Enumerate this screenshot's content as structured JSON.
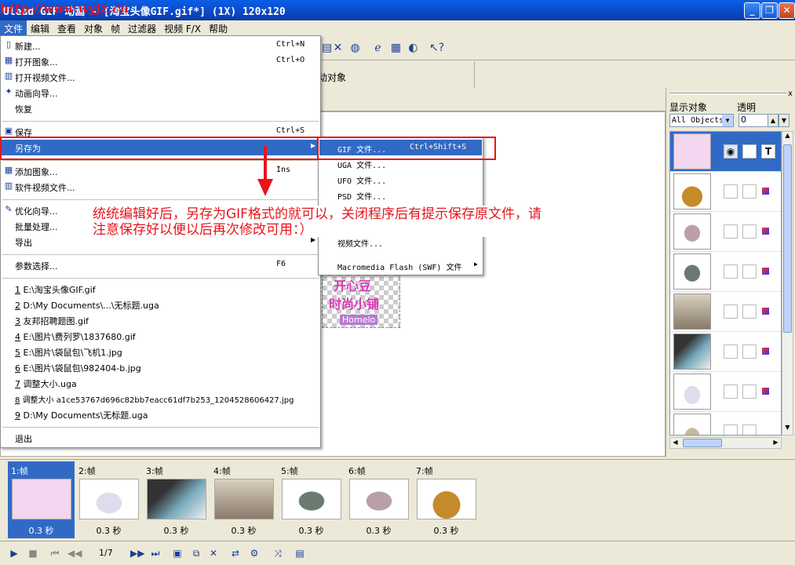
{
  "window": {
    "title": "Ulead GIF 动画 - [淘宝头像GIF.gif*] (1X) 120x120",
    "watermark": "http://www.wyjz.cn"
  },
  "menubar": [
    "文件",
    "编辑",
    "查看",
    "对象",
    "帧",
    "过滤器",
    "视频 F/X",
    "帮助"
  ],
  "toolbar": {
    "panel_label": "动对象"
  },
  "file_menu": {
    "items": [
      {
        "label": "新建...",
        "shortcut": "Ctrl+N",
        "icon": "new-file-icon"
      },
      {
        "label": "打开图象...",
        "shortcut": "Ctrl+O",
        "icon": "open-image-icon"
      },
      {
        "label": "打开视频文件...",
        "shortcut": "",
        "icon": "open-video-icon"
      },
      {
        "label": "动画向导...",
        "shortcut": "",
        "icon": "wizard-icon"
      },
      {
        "label": "恢复",
        "shortcut": "",
        "icon": ""
      },
      {
        "label": "保存",
        "shortcut": "Ctrl+S",
        "icon": "save-icon"
      },
      {
        "label": "另存为",
        "shortcut": "",
        "icon": ""
      },
      {
        "label": "添加图象...",
        "shortcut": "Ins",
        "icon": "add-image-icon"
      },
      {
        "label": "软件视频文件...",
        "shortcut": "",
        "icon": "video-file-icon"
      },
      {
        "label": "优化向导...",
        "shortcut": "",
        "icon": "optimize-icon"
      },
      {
        "label": "批量处理...",
        "shortcut": "",
        "icon": ""
      },
      {
        "label": "导出",
        "shortcut": "",
        "icon": ""
      },
      {
        "label": "参数选择...",
        "shortcut": "F6",
        "icon": ""
      },
      {
        "label": "退出",
        "shortcut": "",
        "icon": ""
      }
    ],
    "recent": [
      {
        "num": "1",
        "path": "E:\\淘宝头像GIF.gif"
      },
      {
        "num": "2",
        "path": "D:\\My Documents\\...\\无标题.uga"
      },
      {
        "num": "3",
        "path": "友邦招聘题图.gif"
      },
      {
        "num": "4",
        "path": "E:\\图片\\费列罗\\1837680.gif"
      },
      {
        "num": "5",
        "path": "E:\\图片\\袋鼠包\\飞机1.jpg"
      },
      {
        "num": "6",
        "path": "E:\\图片\\袋鼠包\\982404-b.jpg"
      },
      {
        "num": "7",
        "path": "调整大小.uga"
      },
      {
        "num": "8",
        "path": "调整大小 a1ce53767d696c82bb7eacc61df7b253_1204528606427.jpg"
      },
      {
        "num": "9",
        "path": "D:\\My Documents\\无标题.uga"
      }
    ]
  },
  "save_as_submenu": [
    {
      "label": "GIF 文件...",
      "shortcut": "Ctrl+Shift+S"
    },
    {
      "label": "UGA 文件...",
      "shortcut": ""
    },
    {
      "label": "UFO 文件...",
      "shortcut": ""
    },
    {
      "label": "PSD 文件...",
      "shortcut": ""
    },
    {
      "label": "视频文件...",
      "shortcut": ""
    },
    {
      "label": "Macromedia Flash (SWF) 文件",
      "shortcut": ""
    }
  ],
  "annotation": "统统编辑好后，另存为GIF格式的就可以，关闭程序后有提示保存原文件，请注意保存好以便以后再次修改可用：）",
  "preview": {
    "line1": "开心豆",
    "line2": "时尚小铺",
    "line3": "Homelo"
  },
  "right_panel": {
    "show_objects_label": "显示对象",
    "transparency_label": "透明",
    "select_value": "All Objects",
    "transparency_value": "0",
    "text_tool_label": "T"
  },
  "frames": [
    {
      "label": "1:帧",
      "delay": "0.3 秒"
    },
    {
      "label": "2:帧",
      "delay": "0.3 秒"
    },
    {
      "label": "3:帧",
      "delay": "0.3 秒"
    },
    {
      "label": "4:帧",
      "delay": "0.3 秒"
    },
    {
      "label": "5:帧",
      "delay": "0.3 秒"
    },
    {
      "label": "6:帧",
      "delay": "0.3 秒"
    },
    {
      "label": "7:帧",
      "delay": "0.3 秒"
    }
  ],
  "frame_counter": "1/7",
  "colors": {
    "highlight": "#316ac5",
    "annotation": "#e8141c"
  }
}
